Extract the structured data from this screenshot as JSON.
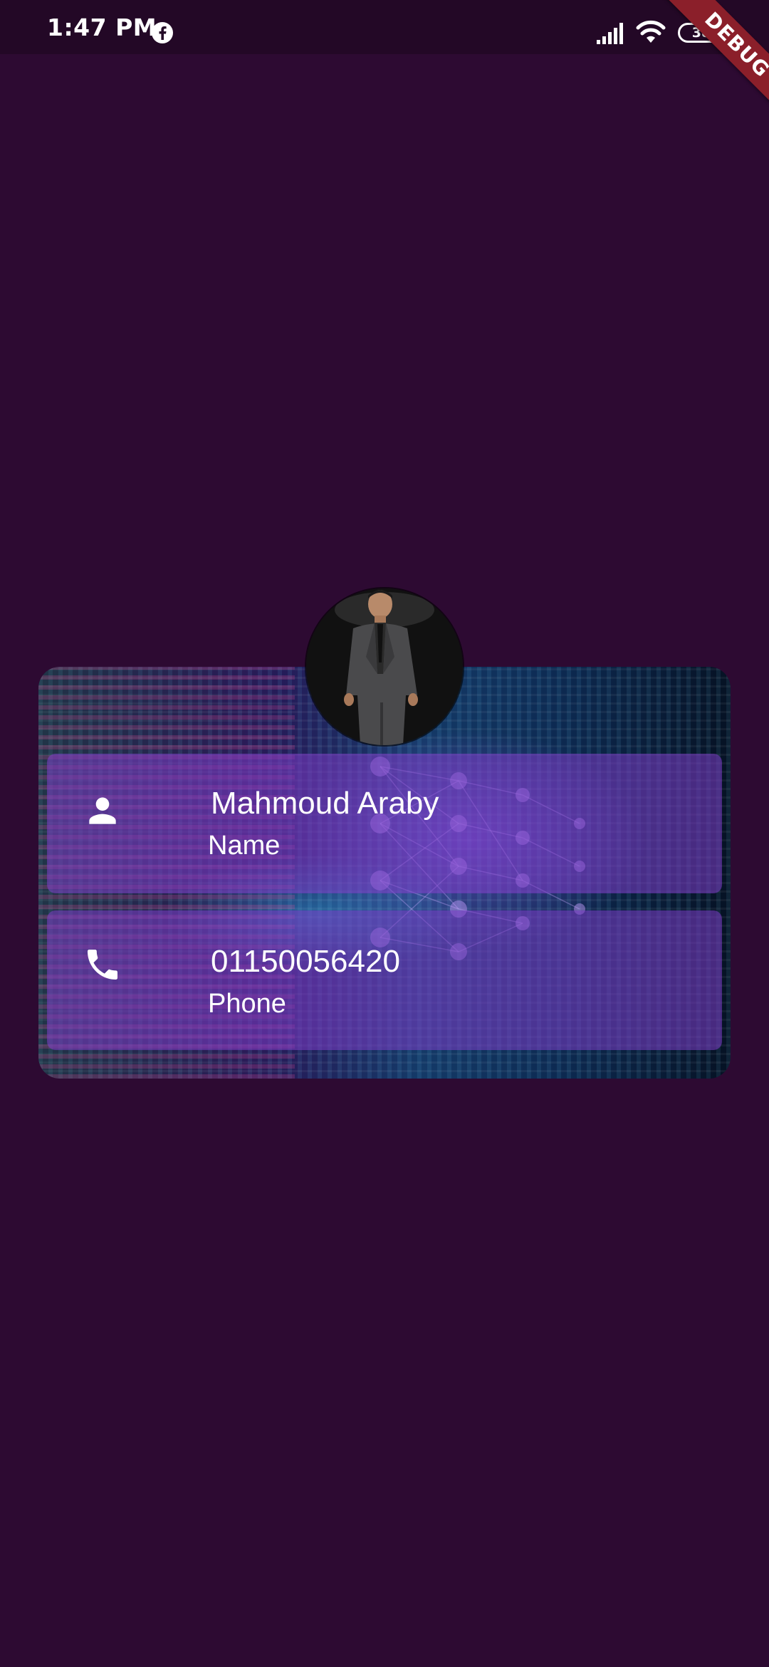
{
  "status_bar": {
    "time": "1:47 PM",
    "battery": "38",
    "icons": [
      "facebook-icon",
      "signal-icon",
      "wifi-icon",
      "battery-icon"
    ]
  },
  "debug_banner": {
    "label": "DEBUG"
  },
  "profile": {
    "name_value": "Mahmoud Araby",
    "name_label": "Name",
    "phone_value": "01150056420",
    "phone_label": "Phone"
  },
  "colors": {
    "background": "#2d0a32",
    "status_bar": "#230826",
    "panel": "#7d3cc8",
    "debug_ribbon": "#8b1f2a",
    "text": "#ffffff"
  }
}
